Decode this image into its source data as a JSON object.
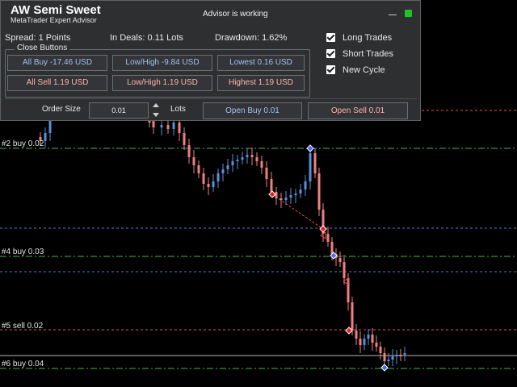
{
  "panel": {
    "title": "AW Semi Sweet",
    "subtitle": "MetaTrader Expert Advisor",
    "status": "Advisor is working",
    "info": {
      "spread": "Spread: 1 Points",
      "in_deals": "In Deals: 0.11 Lots",
      "drawdown": "Drawdown:   1.62%"
    },
    "close_group_label": "Close Buttons",
    "close_buttons": {
      "all_buy": "All Buy -17.46  USD",
      "low_high_1": "Low/High -9.84 USD",
      "lowest": "Lowest 0.16 USD",
      "all_sell": "All Sell 1.19  USD",
      "low_high_2": "Low/High 1.19 USD",
      "highest": "Highest 1.19 USD"
    },
    "checkboxes": {
      "long": "Long Trades",
      "short": "Short Trades",
      "cycle": "New Cycle"
    },
    "order": {
      "size_label": "Order Size",
      "size_value": "0.01",
      "lots_label": "Lots",
      "open_buy": "Open Buy 0.01",
      "open_sell": "Open Sell 0.01"
    }
  },
  "chart": {
    "level_labels": {
      "l2": "#2 buy 0.02",
      "l4": "#4 buy 0.03",
      "l5": "#5 sell 0.02",
      "l6": "#6 buy 0.04"
    },
    "colors": {
      "bull": "#5b8fd6",
      "bear": "#f08080",
      "buy_line": "#4caf50",
      "sell_line": "#e05050",
      "blue_line": "#4a7fd0"
    }
  }
}
